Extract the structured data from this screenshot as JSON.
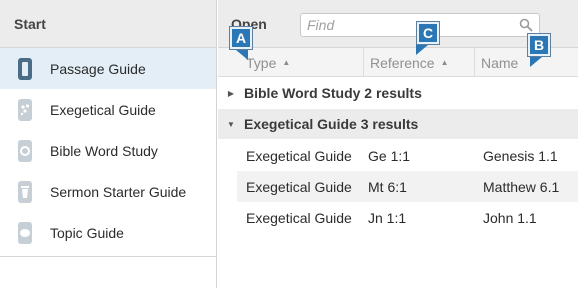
{
  "left_panel": {
    "title": "Start",
    "items": [
      {
        "label": "Passage Guide",
        "icon": "passage-guide-icon",
        "selected": true
      },
      {
        "label": "Exegetical Guide",
        "icon": "exegetical-guide-icon",
        "selected": false
      },
      {
        "label": "Bible Word Study",
        "icon": "bible-word-study-icon",
        "selected": false
      },
      {
        "label": "Sermon Starter Guide",
        "icon": "sermon-starter-guide-icon",
        "selected": false
      },
      {
        "label": "Topic Guide",
        "icon": "topic-guide-icon",
        "selected": false
      }
    ]
  },
  "right_panel": {
    "title": "Open",
    "search": {
      "placeholder": "Find",
      "value": ""
    },
    "columns": {
      "type": "Type",
      "reference": "Reference",
      "name": "Name"
    },
    "groups": [
      {
        "label": "Bible Word Study 2 results",
        "expanded": false
      },
      {
        "label": "Exegetical Guide 3 results",
        "expanded": true,
        "rows": [
          {
            "type": "Exegetical Guide",
            "reference": "Ge 1:1",
            "name": "Genesis 1.1"
          },
          {
            "type": "Exegetical Guide",
            "reference": "Mt 6:1",
            "name": "Matthew 6.1"
          },
          {
            "type": "Exegetical Guide",
            "reference": "Jn 1:1",
            "name": "John 1.1"
          }
        ]
      }
    ]
  },
  "markers": [
    "A",
    "C",
    "B"
  ],
  "colors": {
    "marker": "#2b77b6",
    "selected_row": "#e3eef6",
    "header_bg": "#ececec",
    "icon": "#4a6c86"
  }
}
